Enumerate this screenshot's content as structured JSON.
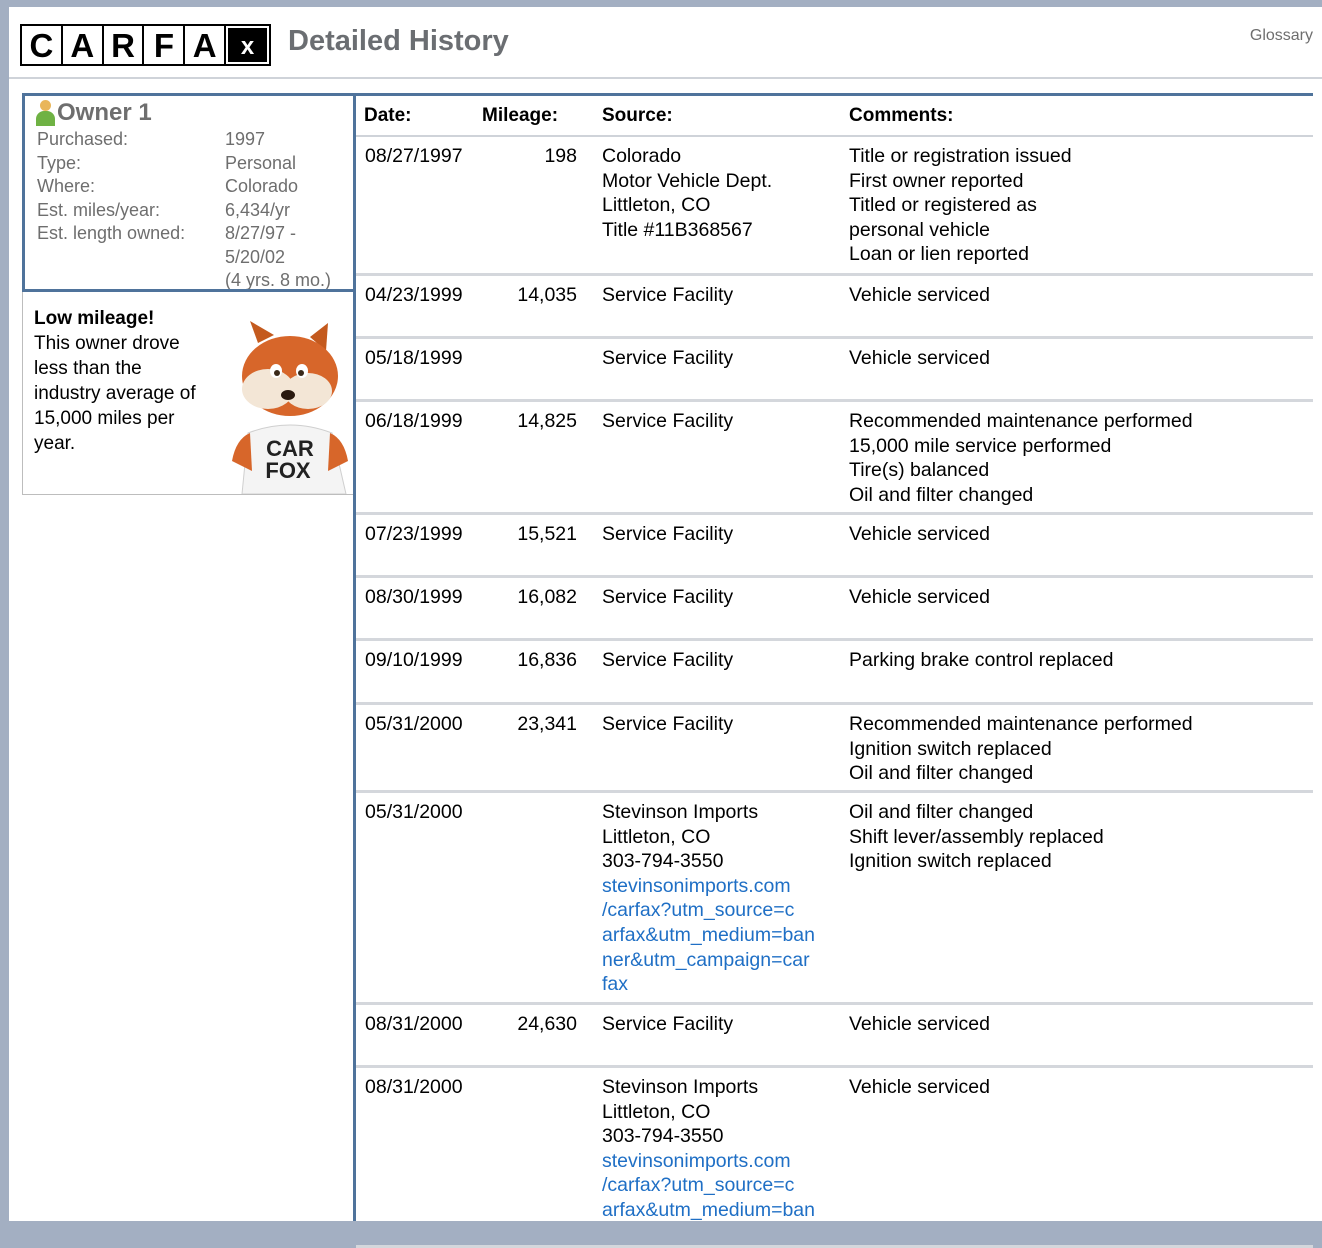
{
  "header": {
    "logo_letters": [
      "C",
      "A",
      "R",
      "F",
      "A",
      "x"
    ],
    "title": "Detailed History",
    "glossary_label": "Glossary"
  },
  "owner": {
    "title": "Owner 1",
    "fields": [
      {
        "label": "Purchased:",
        "value": "1997"
      },
      {
        "label": "Type:",
        "value": "Personal"
      },
      {
        "label": "Where:",
        "value": "Colorado"
      },
      {
        "label": "Est. miles/year:",
        "value": "6,434/yr"
      },
      {
        "label": "Est. length owned:",
        "value": "8/27/97 -"
      },
      {
        "label": "",
        "value": "5/20/02"
      },
      {
        "label": "",
        "value": "(4 yrs. 8 mo.)"
      }
    ]
  },
  "note": {
    "title": "Low mileage!",
    "text": "This owner drove less than the industry average of 15,000 miles per year.",
    "mascot_shirt": [
      "CAR",
      "FOX"
    ]
  },
  "table": {
    "headers": {
      "date": "Date:",
      "mileage": "Mileage:",
      "source": "Source:",
      "comments": "Comments:"
    },
    "rows": [
      {
        "date": "08/27/1997",
        "mileage": "198",
        "source": [
          "Colorado",
          "Motor Vehicle Dept.",
          "Littleton, CO",
          "Title #11B368567"
        ],
        "comments": [
          "Title or registration issued",
          "First owner reported",
          "Titled or registered as",
          "personal vehicle",
          "Loan or lien reported"
        ]
      },
      {
        "date": "04/23/1999",
        "mileage": "14,035",
        "source": [
          "Service Facility"
        ],
        "comments": [
          "Vehicle serviced"
        ]
      },
      {
        "date": "05/18/1999",
        "mileage": "",
        "source": [
          "Service Facility"
        ],
        "comments": [
          "Vehicle serviced"
        ]
      },
      {
        "date": "06/18/1999",
        "mileage": "14,825",
        "source": [
          "Service Facility"
        ],
        "comments": [
          "Recommended maintenance performed",
          "15,000 mile service performed",
          "Tire(s) balanced",
          "Oil and filter changed"
        ]
      },
      {
        "date": "07/23/1999",
        "mileage": "15,521",
        "source": [
          "Service Facility"
        ],
        "comments": [
          "Vehicle serviced"
        ]
      },
      {
        "date": "08/30/1999",
        "mileage": "16,082",
        "source": [
          "Service Facility"
        ],
        "comments": [
          "Vehicle serviced"
        ]
      },
      {
        "date": "09/10/1999",
        "mileage": "16,836",
        "source": [
          "Service Facility"
        ],
        "comments": [
          "Parking brake control replaced"
        ]
      },
      {
        "date": "05/31/2000",
        "mileage": "23,341",
        "source": [
          "Service Facility"
        ],
        "comments": [
          "Recommended maintenance performed",
          "Ignition switch replaced",
          "Oil and filter changed"
        ]
      },
      {
        "date": "05/31/2000",
        "mileage": "",
        "source": [
          "Stevinson Imports",
          "Littleton, CO",
          "303-794-3550"
        ],
        "source_link": [
          "stevinsonimports.com",
          "/carfax?utm_source=c",
          "arfax&utm_medium=ban",
          "ner&utm_campaign=car",
          "fax"
        ],
        "comments": [
          "Oil and filter changed",
          "Shift lever/assembly replaced",
          "Ignition switch replaced"
        ]
      },
      {
        "date": "08/31/2000",
        "mileage": "24,630",
        "source": [
          "Service Facility"
        ],
        "comments": [
          "Vehicle serviced"
        ]
      },
      {
        "date": "08/31/2000",
        "mileage": "",
        "source": [
          "Stevinson Imports",
          "Littleton, CO",
          "303-794-3550"
        ],
        "source_link": [
          "stevinsonimports.com",
          "/carfax?utm_source=c",
          "arfax&utm_medium=ban"
        ],
        "comments": [
          "Vehicle serviced"
        ]
      }
    ]
  }
}
